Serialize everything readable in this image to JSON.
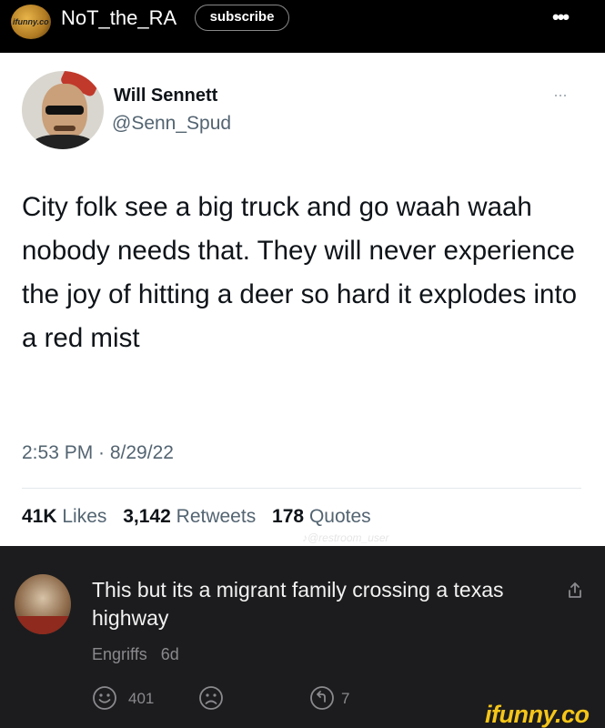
{
  "topbar": {
    "avatar_text": "ifunny.co",
    "username": "NoT_the_RA",
    "subscribe_label": "subscribe",
    "more_label": "•••"
  },
  "tweet": {
    "name": "Will Sennett",
    "handle": "@Senn_Spud",
    "more_label": "···",
    "text": "City folk see a big truck and go waah waah nobody needs that. They will never experience the joy of hitting a deer so hard it explodes into a red mist",
    "timestamp": "2:53 PM · 8/29/22",
    "likes_count": "41K",
    "likes_label": "Likes",
    "retweets_count": "3,142",
    "retweets_label": "Retweets",
    "quotes_count": "178",
    "quotes_label": "Quotes",
    "watermark": "♪@restroom_user"
  },
  "comment": {
    "text": "This but its a migrant family crossing a texas highway",
    "author": "Engriffs",
    "age": "6d",
    "smile_count": "401",
    "reply_count": "7"
  },
  "branding": {
    "logo_text": "ifunny.co",
    "accent": "#f5c518"
  },
  "icons": {
    "share": "share-icon",
    "smile": "smile-icon",
    "frown": "frown-icon",
    "reply": "reply-icon"
  }
}
